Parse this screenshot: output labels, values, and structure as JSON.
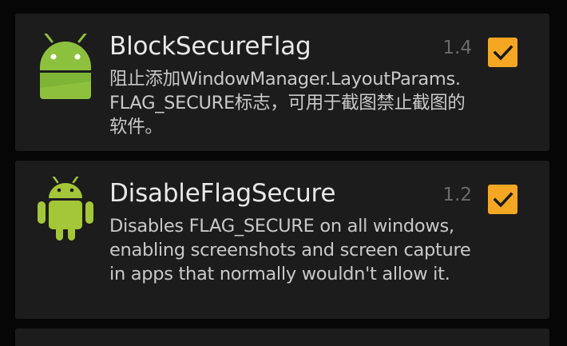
{
  "modules": [
    {
      "title": "BlockSecureFlag",
      "version": "1.4",
      "description": "阻止添加WindowManager.LayoutParams.FLAG_SECURE标志，可用于截图禁止截图的软件。",
      "enabled": true,
      "icon": "android-flat-icon"
    },
    {
      "title": "DisableFlagSecure",
      "version": "1.2",
      "description": "Disables FLAG_SECURE on all windows, enabling screenshots and screen capture in apps that normally wouldn't allow it.",
      "enabled": true,
      "icon": "android-robot-icon"
    }
  ],
  "colors": {
    "checkbox_accent": "#f5a623",
    "android_green": "#a4c639",
    "card_background": "#1c1c1c"
  }
}
